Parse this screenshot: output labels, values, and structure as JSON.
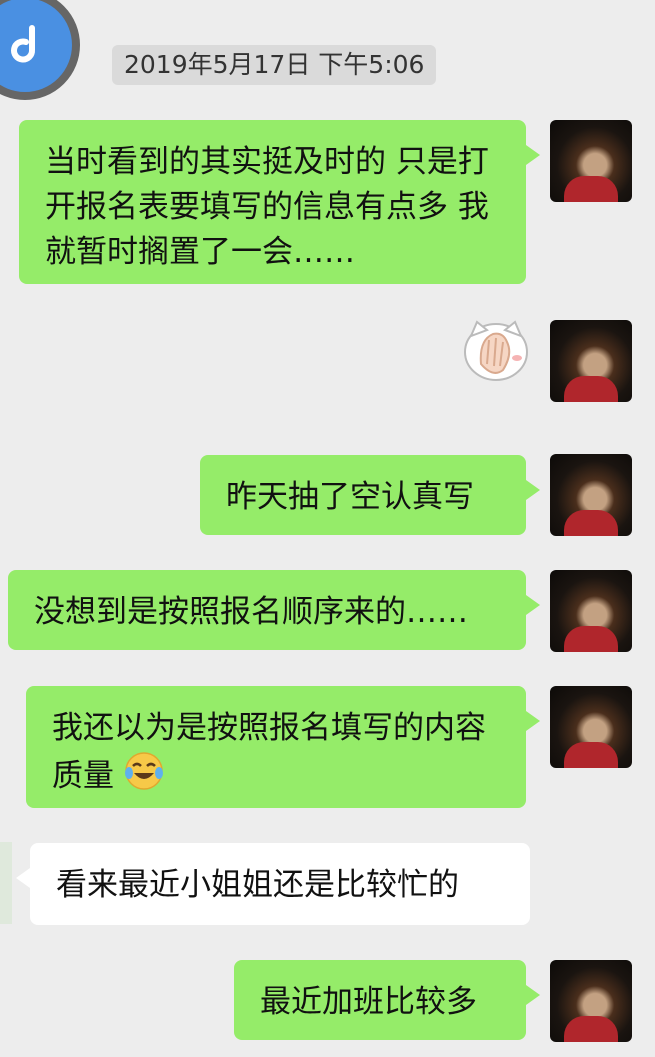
{
  "timestamp": "2019年5月17日 下午5:06",
  "messages": [
    {
      "sender": "me",
      "text": "当时看到的其实挺及时的 只是打开报名表要填写的信息有点多 我就暂时搁置了一会……"
    },
    {
      "sender": "me",
      "type": "sticker",
      "sticker": "cat-covering-face"
    },
    {
      "sender": "me",
      "text": "昨天抽了空认真写"
    },
    {
      "sender": "me",
      "text": "没想到是按照报名顺序来的……"
    },
    {
      "sender": "me",
      "text": "我还以为是按照报名填写的内容质量",
      "emoji": "tears-of-joy"
    },
    {
      "sender": "other",
      "text": "看来最近小姐姐还是比较忙的"
    },
    {
      "sender": "me",
      "text": "最近加班比较多"
    }
  ],
  "colors": {
    "background": "#ededed",
    "my_bubble": "#95ec69",
    "other_bubble": "#ffffff",
    "contact_avatar": "#4a90e2"
  }
}
